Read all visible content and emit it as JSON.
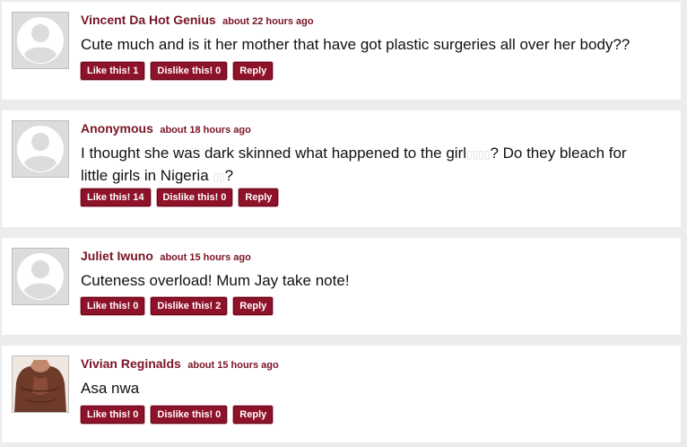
{
  "comments": [
    {
      "author": "Vincent Da Hot Genius",
      "time": "about 22 hours ago",
      "text": "Cute much and is it her mother that have got plastic surgeries all over her body??",
      "likes": "1",
      "dislikes": "0",
      "avatar": "default-avatar"
    },
    {
      "author": "Anonymous",
      "time": "about 18 hours ago",
      "text_line1_part1": "I thought she was dark skinned what happened to the girl",
      "text_line1_glyphs": "▯▯▯▯",
      "text_line1_part2": "? Do they bleach for",
      "text_line2_part1": "little girls in Nigeria",
      "text_line2_glyphs": "▯▯",
      "text_line2_part2": "?",
      "likes": "14",
      "dislikes": "0",
      "avatar": "default-avatar"
    },
    {
      "author": "Juliet Iwuno",
      "time": "about 15 hours ago",
      "text": "Cuteness overload! Mum Jay take note!",
      "likes": "0",
      "dislikes": "2",
      "avatar": "default-avatar"
    },
    {
      "author": "Vivian Reginalds",
      "time": "about 15 hours ago",
      "text": "Asa nwa",
      "likes": "0",
      "dislikes": "0",
      "avatar": "photo-avatar"
    }
  ],
  "buttons": {
    "like_label": "Like this!",
    "dislike_label": "Dislike this!",
    "reply_label": "Reply"
  },
  "colors": {
    "accent": "#8e1229",
    "author": "#7a1426",
    "page_background": "#ececec",
    "card_background": "#ffffff"
  }
}
